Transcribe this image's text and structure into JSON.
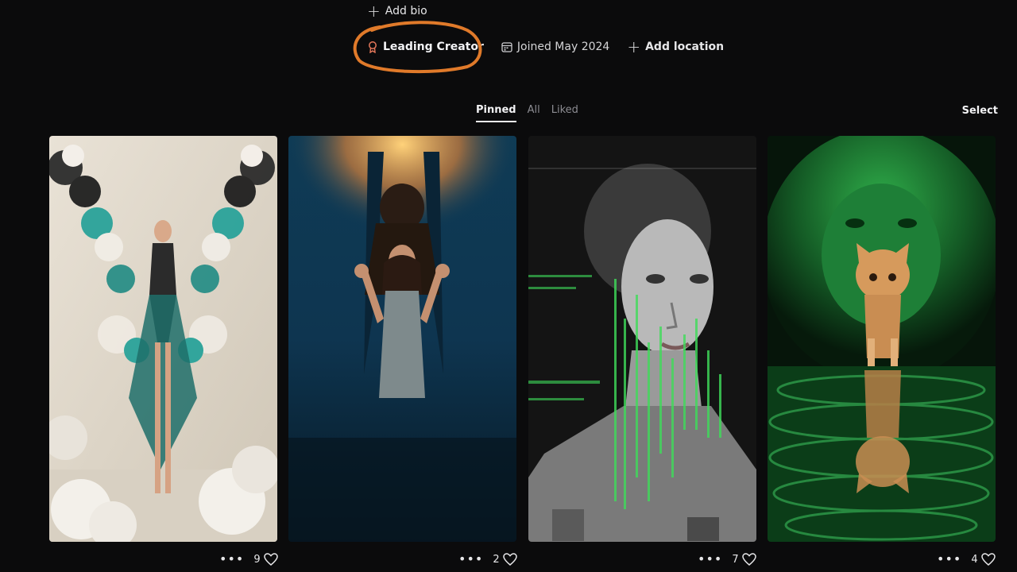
{
  "profile": {
    "add_bio": "Add bio",
    "badge": "Leading Creator",
    "joined": "Joined May 2024",
    "add_location": "Add location"
  },
  "tabs": [
    {
      "label": "Pinned",
      "active": true
    },
    {
      "label": "All",
      "active": false
    },
    {
      "label": "Liked",
      "active": false
    }
  ],
  "select_label": "Select",
  "more_label": "•••",
  "accent": {
    "annotation": "#e07a2a",
    "badge_icon": "#e4775a"
  },
  "posts": [
    {
      "subject": "smoke-dress-figure",
      "likes": "9"
    },
    {
      "subject": "underwater-woman",
      "likes": "2"
    },
    {
      "subject": "glitch-portrait",
      "likes": "7"
    },
    {
      "subject": "kitten-lion-reflection",
      "likes": "4"
    }
  ]
}
